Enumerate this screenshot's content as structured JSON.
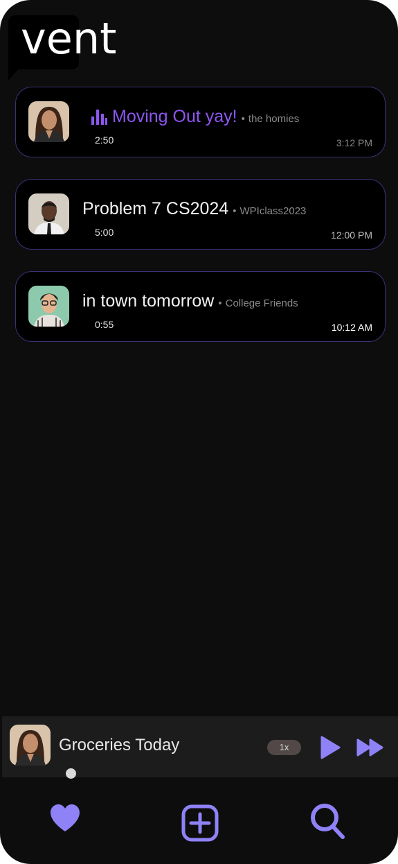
{
  "app": {
    "logo_text": "vent",
    "accent_color": "#8f82f7",
    "card_border_color": "#3a3377",
    "now_playing_title_color": "#8e56f0"
  },
  "conversations": [
    {
      "title": "Moving Out yay!",
      "group": "the homies",
      "duration": "2:50",
      "time": "3:12 PM",
      "playing": true,
      "avatar_icon": "woman-avatar"
    },
    {
      "title": "Problem 7 CS2024",
      "group": "WPIclass2023",
      "duration": "5:00",
      "time": "12:00 PM",
      "playing": false,
      "avatar_icon": "man-avatar"
    },
    {
      "title": "in town tomorrow",
      "group": "College Friends",
      "duration": "0:55",
      "time": "10:12 AM",
      "playing": false,
      "avatar_icon": "man-glasses-avatar"
    }
  ],
  "separator": "•",
  "player": {
    "title": "Groceries Today",
    "speed": "1x",
    "avatar_icon": "woman-avatar",
    "play_icon": "play-icon",
    "forward_icon": "fast-forward-icon"
  },
  "nav": {
    "items": [
      {
        "icon": "heart-icon"
      },
      {
        "icon": "add-square-icon"
      },
      {
        "icon": "search-icon"
      }
    ]
  }
}
